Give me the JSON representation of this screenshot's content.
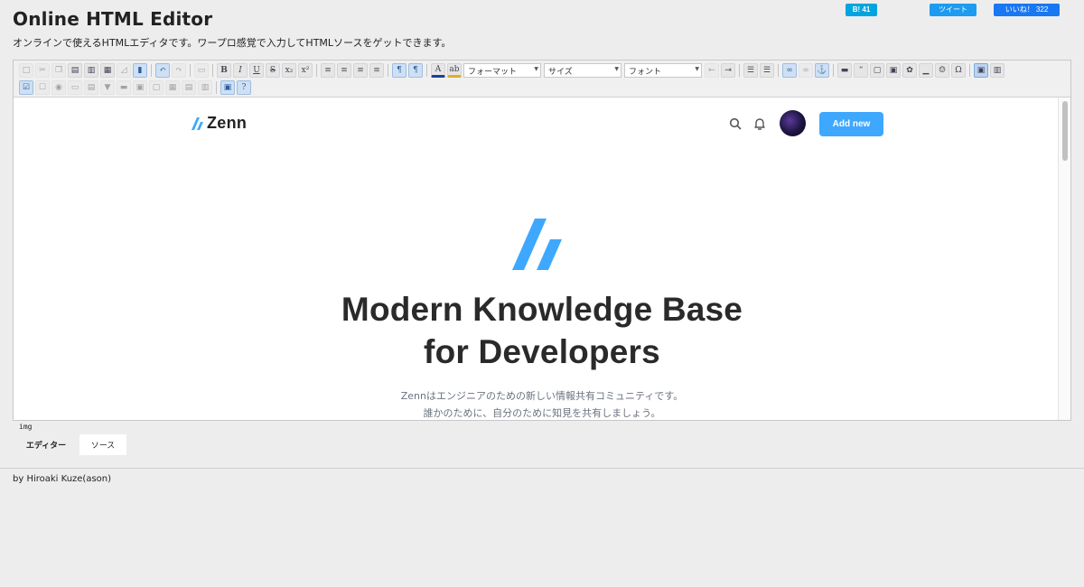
{
  "page": {
    "title": "Online HTML Editor",
    "subtitle": "オンラインで使えるHTMLエディタです。ワープロ感覚で入力してHTMLソースをゲットできます。"
  },
  "social": {
    "hatena": "B! 41",
    "tweet": "ツイート",
    "like": "いいね！ 322"
  },
  "toolbar": {
    "format_label": "フォーマット",
    "size_label": "サイズ",
    "font_label": "フォント"
  },
  "preview": {
    "logo_text": "Zenn",
    "add_new": "Add new",
    "hero_line1": "Modern Knowledge Base",
    "hero_line2": "for Developers",
    "desc_line1": "Zennはエンジニアのための新しい情報共有コミュニティです。",
    "desc_line2": "誰かのために、自分のために知見を共有しましょう。"
  },
  "status": {
    "element_path": "img"
  },
  "tabs": {
    "editor": "エディター",
    "source": "ソース"
  },
  "footer": {
    "credit": "by Hiroaki Kuze(ason)"
  },
  "colors": {
    "accent": "#3ea8ff",
    "background": "#ededed"
  }
}
